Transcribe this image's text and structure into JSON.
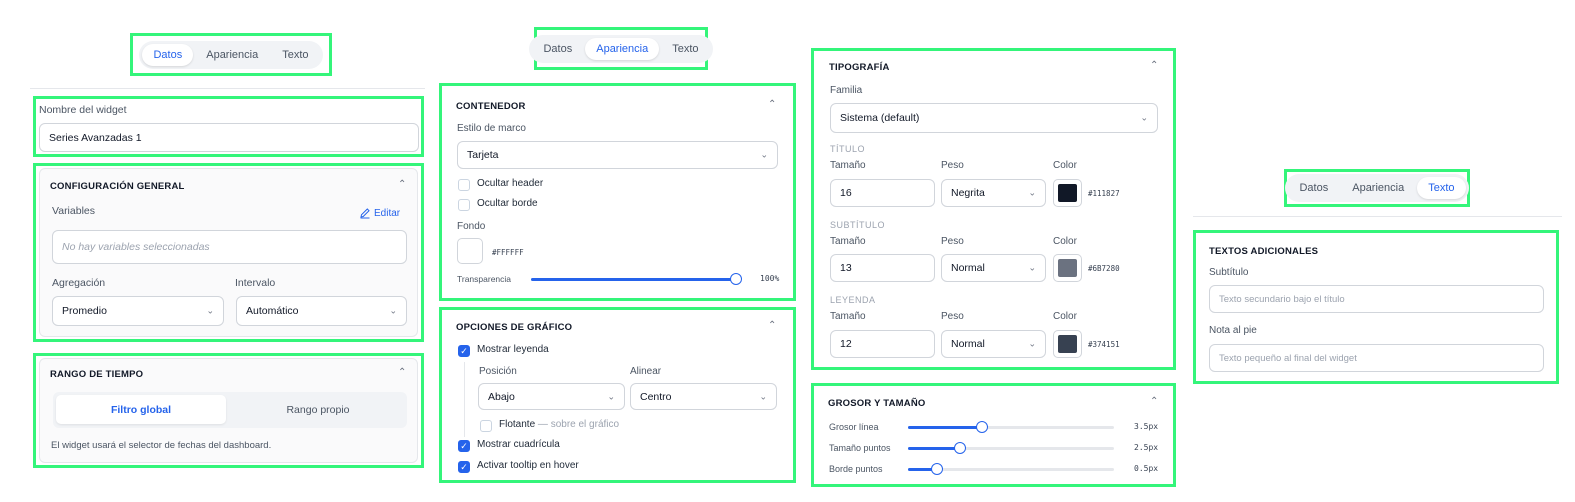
{
  "tabs": [
    "Datos",
    "Apariencia",
    "Texto"
  ],
  "panel_datos": {
    "widget_name_label": "Nombre del widget",
    "widget_name_value": "Series Avanzadas 1",
    "general": {
      "title": "CONFIGURACIÓN GENERAL",
      "variables_label": "Variables",
      "edit_label": "Editar",
      "variables_placeholder": "No hay variables seleccionadas",
      "aggregation_label": "Agregación",
      "aggregation_value": "Promedio",
      "interval_label": "Intervalo",
      "interval_value": "Automático"
    },
    "time_range": {
      "title": "RANGO DE TIEMPO",
      "option_global": "Filtro global",
      "option_custom": "Rango propio",
      "note": "El widget usará el selector de fechas del dashboard."
    }
  },
  "panel_apariencia": {
    "container": {
      "title": "CONTENEDOR",
      "frame_label": "Estilo de marco",
      "frame_value": "Tarjeta",
      "hide_header": "Ocultar header",
      "hide_border": "Ocultar borde",
      "background_label": "Fondo",
      "background_hex": "#FFFFFF",
      "background_color": "#ffffff",
      "transparency_label": "Transparencia",
      "transparency_value": "100%",
      "transparency_fraction": 1.0
    },
    "chart_options": {
      "title": "OPCIONES DE GRÁFICO",
      "show_legend": "Mostrar leyenda",
      "position_label": "Posición",
      "position_value": "Abajo",
      "align_label": "Alinear",
      "align_value": "Centro",
      "floating_label": "Flotante",
      "floating_hint": "— sobre el gráfico",
      "show_grid": "Mostrar cuadrícula",
      "tooltip": "Activar tooltip en hover"
    }
  },
  "panel_tipografia": {
    "title": "TIPOGRAFÍA",
    "family_label": "Familia",
    "family_value": "Sistema (default)",
    "size_label": "Tamaño",
    "weight_label": "Peso",
    "color_label": "Color",
    "groups": [
      {
        "name": "TÍTULO",
        "size": "16",
        "weight": "Negrita",
        "hex": "#111827",
        "color": "#111827"
      },
      {
        "name": "SUBTÍTULO",
        "size": "13",
        "weight": "Normal",
        "hex": "#6B7280",
        "color": "#6b7280"
      },
      {
        "name": "LEYENDA",
        "size": "12",
        "weight": "Normal",
        "hex": "#374151",
        "color": "#374151"
      }
    ]
  },
  "panel_grosor": {
    "title": "GROSOR Y TAMAÑO",
    "sliders": [
      {
        "label": "Grosor línea",
        "value": "3.5px",
        "fraction": 0.36
      },
      {
        "label": "Tamaño puntos",
        "value": "2.5px",
        "fraction": 0.25
      },
      {
        "label": "Borde puntos",
        "value": "0.5px",
        "fraction": 0.14
      }
    ]
  },
  "panel_texto": {
    "title": "TEXTOS ADICIONALES",
    "subtitle_label": "Subtítulo",
    "subtitle_placeholder": "Texto secundario bajo el título",
    "footnote_label": "Nota al pie",
    "footnote_placeholder": "Texto pequeño al final del widget"
  },
  "colors": {
    "highlight": "#34f57a",
    "accent": "#2563eb"
  }
}
